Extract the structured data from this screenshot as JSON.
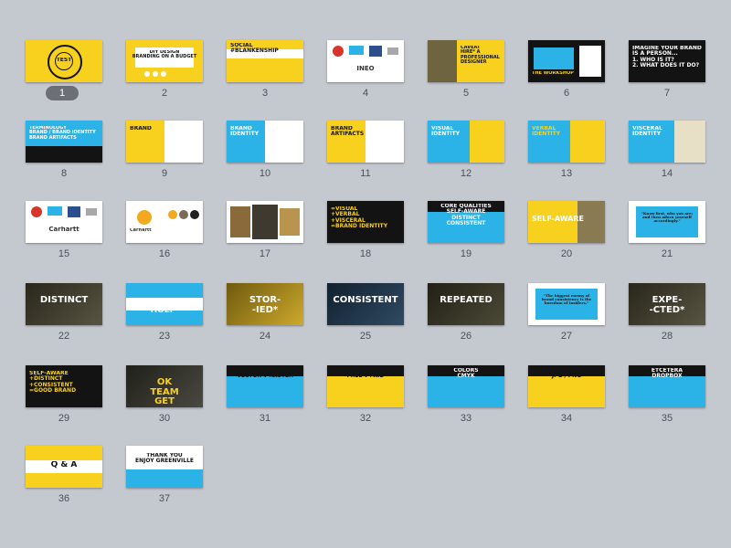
{
  "colors": {
    "yellow": "#f7d11e",
    "blue": "#2bb3e8",
    "black": "#131313",
    "white": "#ffffff"
  },
  "selected": 1,
  "slides": [
    {
      "n": "1",
      "bg": "#f7d11e",
      "text": "TEST",
      "tc": "#131313",
      "style": "target"
    },
    {
      "n": "2",
      "bg": "#f7d11e",
      "text": "DIY DESIGN\nBRANDING ON A BUDGET",
      "tc": "#131313",
      "style": "whitebox"
    },
    {
      "n": "3",
      "bg": "#f7d11e",
      "text": "SOCIAL\n#BLANKENSHIP",
      "tc": "#131313",
      "style": "topwhite"
    },
    {
      "n": "4",
      "bg": "#ffffff",
      "text": "INEŌ",
      "tc": "#333333",
      "style": "logos"
    },
    {
      "n": "5",
      "bg": "#f7d11e",
      "text": "CAVEAT\nHIRE* A\nPROFESSIONAL\nDESIGNER",
      "tc": "#131313",
      "style": "photoleft"
    },
    {
      "n": "6",
      "bg": "#131313",
      "text": "THE WORKSHOP",
      "tc": "#f7d11e",
      "style": "bluebox"
    },
    {
      "n": "7",
      "bg": "#131313",
      "text": "IMAGINE YOUR BRAND\nIS A PERSON...\n1. WHO IS IT?\n2. WHAT DOES IT DO?",
      "tc": "#ffffff",
      "style": "plain"
    },
    {
      "n": "8",
      "bg": "#2bb3e8",
      "text": "TERMINOLOGY\nBRAND / BRAND IDENTITY\nBRAND ARTIFACTS",
      "tc": "#ffffff",
      "style": "bottomblack"
    },
    {
      "n": "9",
      "bg": "#f7d11e",
      "text": "BRAND",
      "tc": "#131313",
      "style": "splitwhite"
    },
    {
      "n": "10",
      "bg": "#2bb3e8",
      "text": "BRAND\nIDENTITY",
      "tc": "#ffffff",
      "style": "splitwhite"
    },
    {
      "n": "11",
      "bg": "#f7d11e",
      "text": "BRAND\nARTIFACTS",
      "tc": "#131313",
      "style": "splitwhite"
    },
    {
      "n": "12",
      "bg": "#2bb3e8",
      "text": "VISUAL\nIDENTITY",
      "tc": "#ffffff",
      "style": "rightyellow"
    },
    {
      "n": "13",
      "bg": "#2bb3e8",
      "text": "VERBAL\nIDENTITY",
      "tc": "#f7d11e",
      "style": "rightyellow"
    },
    {
      "n": "14",
      "bg": "#2bb3e8",
      "text": "VISCERAL\nIDENTITY",
      "tc": "#ffffff",
      "style": "rightwhite"
    },
    {
      "n": "15",
      "bg": "#ffffff",
      "text": "Carhartt",
      "tc": "#333333",
      "style": "logos"
    },
    {
      "n": "16",
      "bg": "#ffffff",
      "text": "Carhartt",
      "tc": "#333333",
      "style": "dots"
    },
    {
      "n": "17",
      "bg": "#ffffff",
      "text": "",
      "tc": "#333333",
      "style": "collage"
    },
    {
      "n": "18",
      "bg": "#131313",
      "text": "=VISUAL\n+VERBAL\n+VISCERAL\n=BRAND IDENTITY",
      "tc": "#f7d11e",
      "style": "plain"
    },
    {
      "n": "19",
      "bg": "#2bb3e8",
      "text": "CORE QUALITIES\nSELF-AWARE\nDISTINCT\nCONSISTENT",
      "tc": "#ffffff",
      "style": "topblack"
    },
    {
      "n": "20",
      "bg": "#f7d11e",
      "text": "SELF-AWARE",
      "tc": "#ffffff",
      "style": "photoright"
    },
    {
      "n": "21",
      "bg": "#ffffff",
      "text": "\"Know first, who you are; and then adorn yourself accordingly.\"",
      "tc": "#131313",
      "style": "quote"
    },
    {
      "n": "22",
      "bg": "#4a4632",
      "text": "DISTINCT",
      "tc": "#ffffff",
      "style": "photo"
    },
    {
      "n": "23",
      "bg": "#2bb3e8",
      "text": "DISTINCT\nHOLY*",
      "tc": "#ffffff",
      "style": "centerwhite"
    },
    {
      "n": "24",
      "bg": "#c9a21a",
      "text": "STOR-\n-IED*",
      "tc": "#ffffff",
      "style": "photo"
    },
    {
      "n": "25",
      "bg": "#1e3b55",
      "text": "CONSISTENT",
      "tc": "#ffffff",
      "style": "photo"
    },
    {
      "n": "26",
      "bg": "#3d3a26",
      "text": "REPEATED",
      "tc": "#ffffff",
      "style": "photo"
    },
    {
      "n": "27",
      "bg": "#ffffff",
      "text": "\"The biggest enemy of brand consistency is the boredom of insiders.\"",
      "tc": "#131313",
      "style": "quote"
    },
    {
      "n": "28",
      "bg": "#4a4632",
      "text": "EXPE-\n-CTED*",
      "tc": "#ffffff",
      "style": "photo"
    },
    {
      "n": "29",
      "bg": "#131313",
      "text": "SELF-AWARE\n+DISTINCT\n+CONSISTENT\n=GOOD BRAND",
      "tc": "#f7d11e",
      "style": "plain"
    },
    {
      "n": "30",
      "bg": "#3a3a30",
      "text": "OK\nTEAM\nGET\nPRACTICAL",
      "tc": "#f7d11e",
      "style": "photo"
    },
    {
      "n": "31",
      "bg": "#2bb3e8",
      "text": "PROGRAMS\nVECTOR v RASTER",
      "tc": "#131313",
      "style": "topblack"
    },
    {
      "n": "32",
      "bg": "#f7d11e",
      "text": "FONTS\nFREE v PAID",
      "tc": "#131313",
      "style": "topblack"
    },
    {
      "n": "33",
      "bg": "#2bb3e8",
      "text": "COLORS\nCMYK",
      "tc": "#ffffff",
      "style": "topblack"
    },
    {
      "n": "34",
      "bg": "#f7d11e",
      "text": "FILE TYPES\nJPG / PNG",
      "tc": "#131313",
      "style": "topblack"
    },
    {
      "n": "35",
      "bg": "#2bb3e8",
      "text": "ETCETERA\nDROPBOX",
      "tc": "#ffffff",
      "style": "topblack"
    },
    {
      "n": "36",
      "bg": "#f7d11e",
      "text": "Q & A",
      "tc": "#131313",
      "style": "centerwhite"
    },
    {
      "n": "37",
      "bg": "#ffffff",
      "text": "THANK YOU\nENJOY GREENVILLE",
      "tc": "#131313",
      "style": "bottomblue"
    }
  ]
}
